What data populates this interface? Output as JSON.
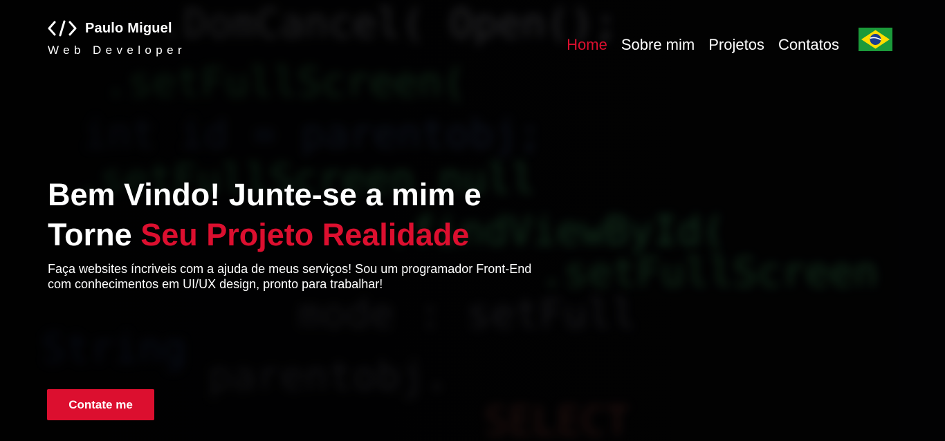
{
  "brand": {
    "icon": "code-brackets-icon",
    "name": "Paulo Miguel",
    "subtitle": "Web Developer"
  },
  "nav": {
    "items": [
      {
        "label": "Home",
        "active": true
      },
      {
        "label": "Sobre mim",
        "active": false
      },
      {
        "label": "Projetos",
        "active": false
      },
      {
        "label": "Contatos",
        "active": false
      }
    ],
    "language_flag": "brazil-flag-icon"
  },
  "hero": {
    "title_line1": "Bem Vindo! Junte-se a mim e",
    "title_line2_plain": "Torne",
    "title_line2_accent": "Seu Projeto Realidade",
    "description": "Faça websites íncriveis com a ajuda de meus serviços! Sou um programador Front-End com conhecimentos em UI/UX design, pronto para trabalhar!",
    "cta_label": "Contate me"
  },
  "colors": {
    "accent": "#dc0f2f",
    "background": "#020203",
    "text": "#ffffff"
  }
}
